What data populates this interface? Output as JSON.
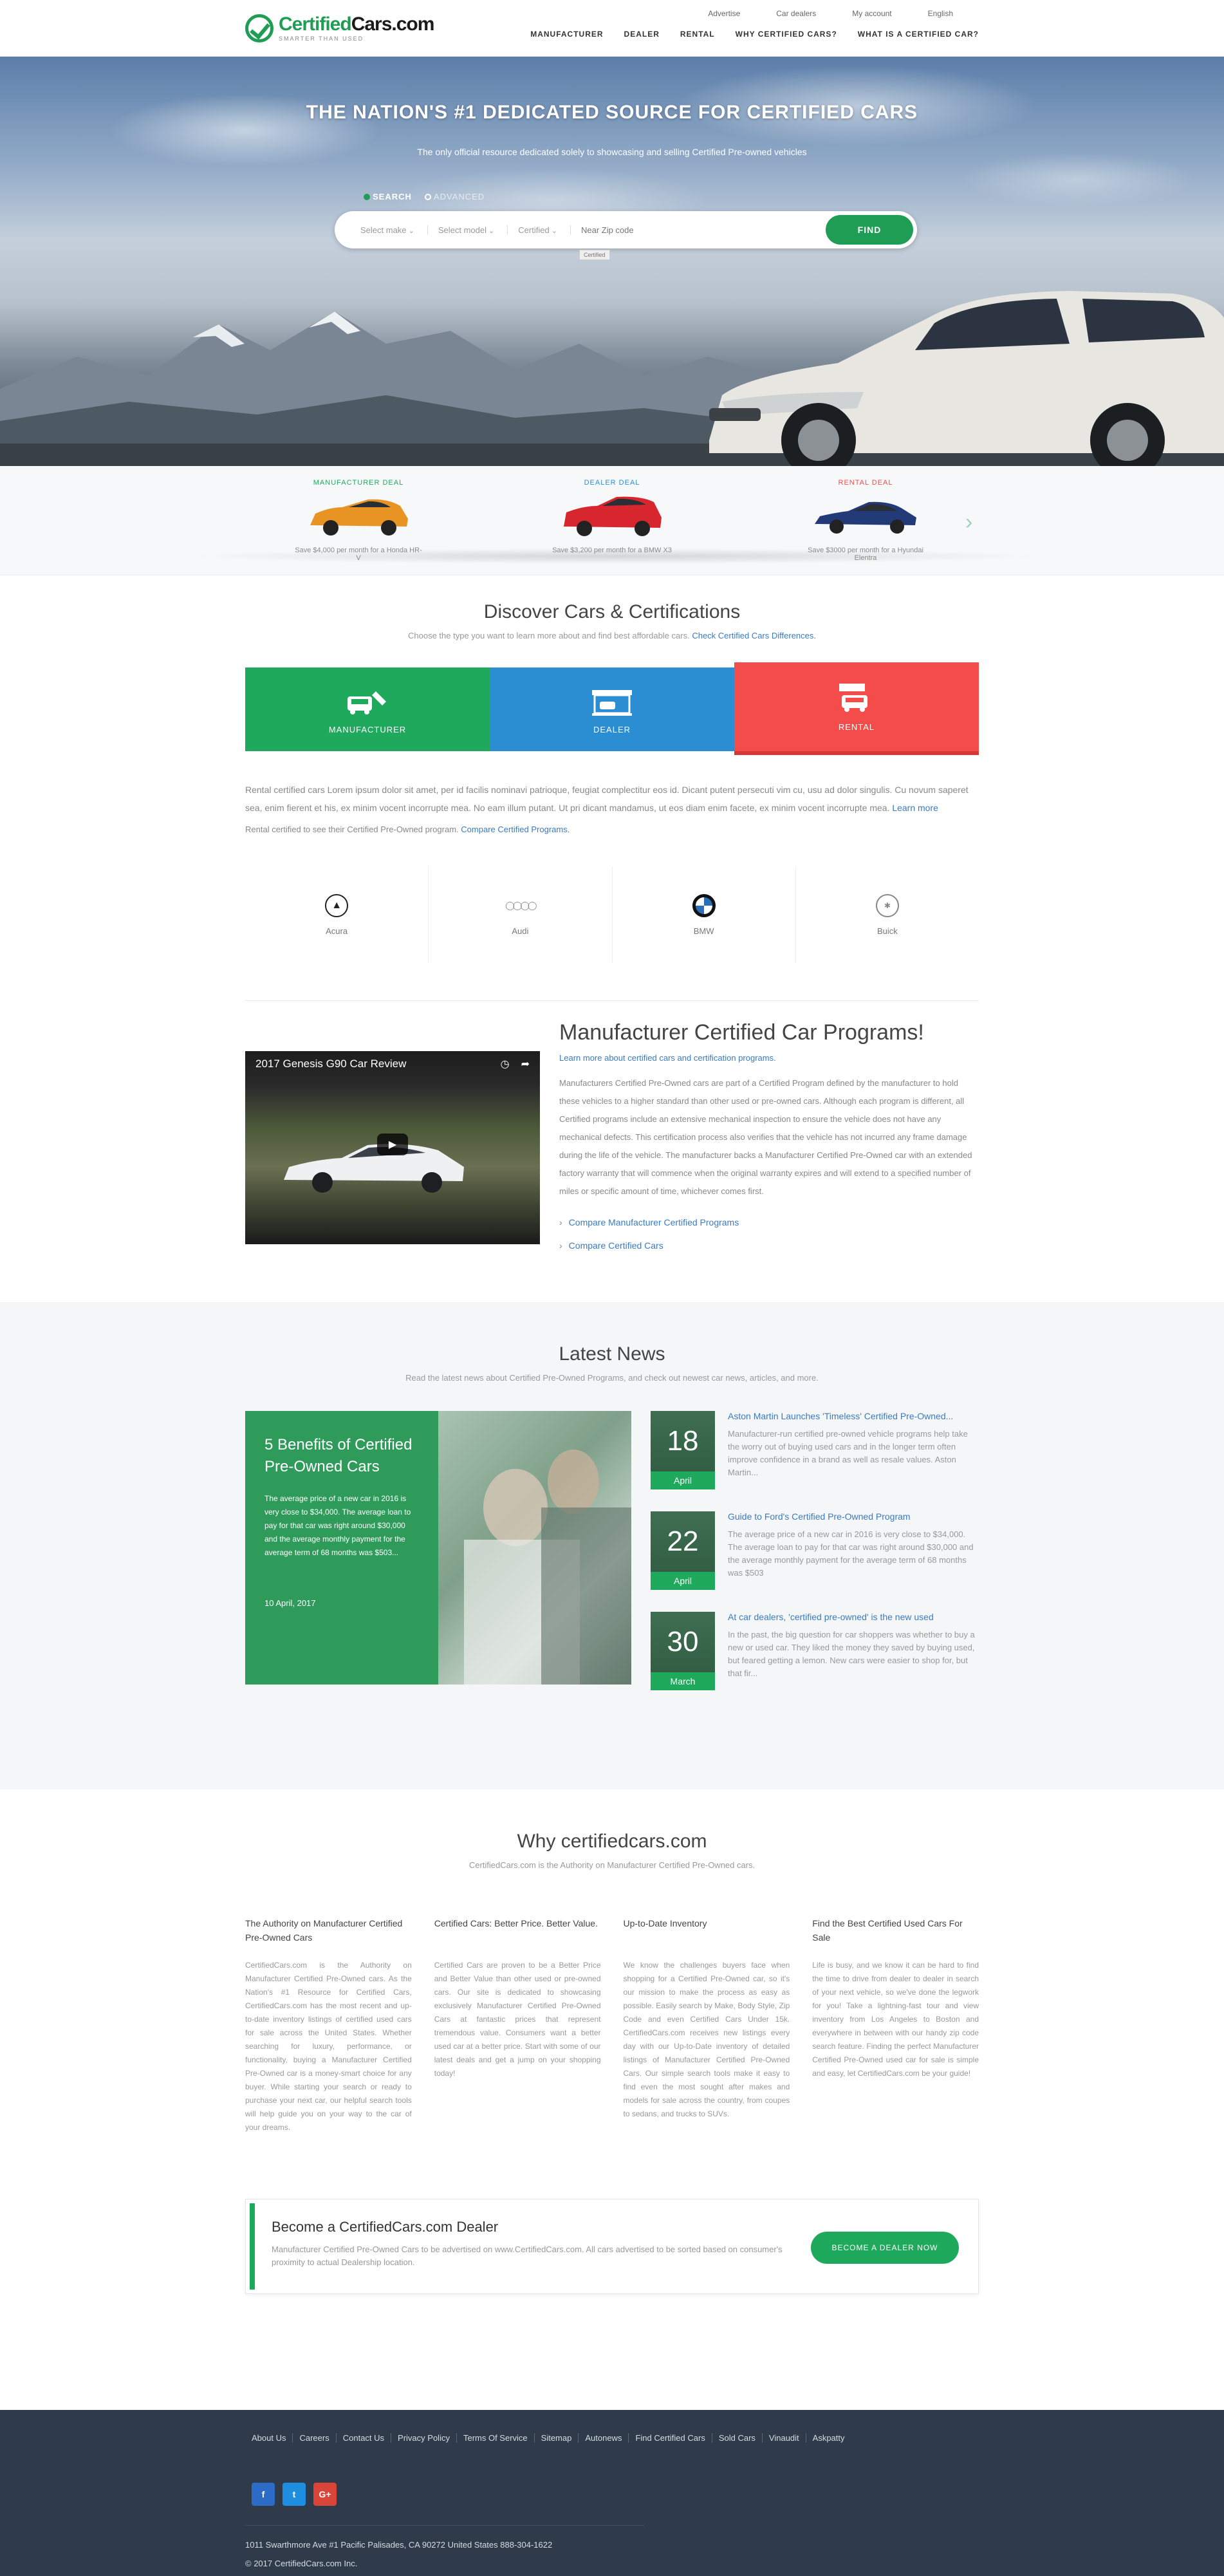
{
  "brand": {
    "name_a": "Certified",
    "name_b": "Cars",
    "name_c": ".com",
    "tagline": "SMARTER THAN USED"
  },
  "topnav": [
    "Advertise",
    "Car dealers",
    "My account",
    "English"
  ],
  "mainnav": [
    "MANUFACTURER",
    "DEALER",
    "RENTAL",
    "WHY CERTIFIED CARS?",
    "WHAT IS A CERTIFIED CAR?"
  ],
  "hero": {
    "title": "THE NATION'S #1 DEDICATED SOURCE FOR CERTIFIED CARS",
    "subtitle": "The only official resource dedicated solely to showcasing and selling Certified Pre-owned vehicles",
    "tab_search": "SEARCH",
    "tab_advanced": "ADVANCED",
    "select_make": "Select make",
    "select_model": "Select model",
    "certified": "Certified",
    "zip_placeholder": "Near Zip code",
    "find": "FIND",
    "cert_tip": "Certified"
  },
  "deals": [
    {
      "title": "MANUFACTURER DEAL",
      "note": "Save $4,000 per month for a Honda HR-V",
      "color": "#1fa95c",
      "car_color": "#e89424"
    },
    {
      "title": "DEALER DEAL",
      "note": "Save $3,200 per month for a BMW X3",
      "color": "#2b8ed2",
      "car_color": "#d8262e"
    },
    {
      "title": "RENTAL DEAL",
      "note": "Save $3000 per month for a Hyundai Elentra",
      "color": "#f44b4b",
      "car_color": "#233a78"
    }
  ],
  "discover": {
    "title": "Discover Cars & Certifications",
    "subtitle": "Choose the type you want to learn more about and find best affordable cars.",
    "subtitle_link": "Check Certified Cars Differences.",
    "tiles": [
      "MANUFACTURER",
      "DEALER",
      "RENTAL"
    ],
    "body": "Rental certified cars Lorem ipsum dolor sit amet, per id facilis nominavi patrioque, feugiat complectitur eos id. Dicant putent persecuti vim cu, usu ad dolor singulis. Cu novum saperet sea, enim fierent et his, ex minim vocent incorrupte mea. No eam illum putant. Ut pri dicant mandamus, ut eos diam enim facete, ex minim vocent incorrupte mea. Learn more",
    "body_link": "Learn more",
    "body2": "Rental certified to see their Certified Pre-Owned program.",
    "body2_link": "Compare Certified Programs.",
    "brands": [
      "Acura",
      "Audi",
      "BMW",
      "Buick"
    ]
  },
  "programs": {
    "video_title": "2017 Genesis G90 Car Review",
    "title": "Manufacturer Certified Car Programs!",
    "lead": "Learn more about certified cars and certification programs.",
    "body": "Manufacturers Certified Pre-Owned cars are part of a Certified Program defined by the manufacturer to hold these vehicles to a higher standard than other used or pre-owned cars. Although each program is different, all Certified programs include an extensive mechanical inspection to ensure the vehicle does not have any mechanical defects. This certification process also verifies that the vehicle has not incurred any frame damage during the life of the vehicle. The manufacturer backs a Manufacturer Certified Pre-Owned car with an extended factory warranty that will commence when the original warranty expires and will extend to a specified number of miles or specific amount of time, whichever comes first.",
    "links": [
      "Compare Manufacturer Certified Programs",
      "Compare Certified Cars"
    ]
  },
  "news": {
    "title": "Latest News",
    "subtitle": "Read the latest news about Certified Pre-Owned Programs, and check out newest car news, articles, and more.",
    "feature": {
      "title": "5 Benefits of Certified Pre-Owned Cars",
      "body": "The average price of a new car in 2016 is very close to $34,000. The average loan to pay for that car was right around $30,000 and the average monthly payment for the average term of 68 months was $503...",
      "date": "10 April, 2017"
    },
    "items": [
      {
        "day": "18",
        "month": "April",
        "title": "Aston Martin Launches 'Timeless' Certified Pre-Owned...",
        "body": "Manufacturer-run certified pre-owned vehicle programs help take the worry out of buying used cars and in the longer term often improve confidence in a brand as well as resale values. Aston Martin..."
      },
      {
        "day": "22",
        "month": "April",
        "title": "Guide to Ford's Certified Pre-Owned Program",
        "body": "The average price of a new car in 2016 is very close to $34,000. The average loan to pay for that car was right around $30,000 and the average monthly payment for the average term of 68 months was $503"
      },
      {
        "day": "30",
        "month": "March",
        "title": "At car dealers, 'certified pre-owned' is the new used",
        "body": "In the past, the big question for car shoppers was whether to buy a new or used car. They liked the money they saved by buying used, but feared getting a lemon. New cars were easier to shop for, but that fir..."
      }
    ]
  },
  "why": {
    "title": "Why certifiedcars.com",
    "subtitle": "CertifiedCars.com is the Authority on Manufacturer Certified Pre-Owned cars.",
    "cols": [
      {
        "title": "The Authority on Manufacturer Certified Pre-Owned Cars",
        "body": "CertifiedCars.com is the Authority on Manufacturer Certified Pre-Owned cars. As the Nation's #1 Resource for Certified Cars, CertifiedCars.com has the most recent and up-to-date inventory listings of certified used cars for sale across the United States. Whether searching for luxury, performance, or functionality, buying a Manufacturer Certified Pre-Owned car is a money-smart choice for any buyer. While starting your search or ready to purchase your next car, our helpful search tools will help guide you on your way to the car of your dreams."
      },
      {
        "title": "Certified Cars: Better Price. Better Value.",
        "body": "Certified Cars are proven to be a Better Price and Better Value than other used or pre-owned cars. Our site is dedicated to showcasing exclusively Manufacturer Certified Pre-Owned Cars at fantastic prices that represent tremendous value. Consumers want a better used car at a better price. Start with some of our latest deals and get a jump on your shopping today!"
      },
      {
        "title": "Up-to-Date Inventory",
        "body": "We know the challenges buyers face when shopping for a Certified Pre-Owned car, so it's our mission to make the process as easy as possible. Easily search by Make, Body Style, Zip Code and even Certified Cars Under 15k. CertifiedCars.com receives new listings every day with our Up-to-Date inventory of detailed listings of Manufacturer Certified Pre-Owned Cars. Our simple search tools make it easy to find even the most sought after makes and models for sale across the country, from coupes to sedans, and trucks to SUVs."
      },
      {
        "title": "Find the Best Certified Used Cars For Sale",
        "body": "Life is busy, and we know it can be hard to find the time to drive from dealer to dealer in search of your next vehicle, so we've done the legwork for you! Take a lightning-fast tour and view inventory from Los Angeles to Boston and everywhere in between with our handy zip code search feature. Finding the perfect Manufacturer Certified Pre-Owned used car for sale is simple and easy, let CertifiedCars.com be your guide!"
      }
    ]
  },
  "dealer_cta": {
    "title": "Become a CertifiedCars.com Dealer",
    "body": "Manufacturer Certified Pre-Owned Cars to be advertised on www.CertifiedCars.com. All cars advertised to be sorted based on consumer's proximity to actual Dealership location.",
    "button": "BECOME A DEALER NOW"
  },
  "footer": {
    "links": [
      "About Us",
      "Careers",
      "Contact Us",
      "Privacy Policy",
      "Terms Of Service",
      "Sitemap",
      "Autonews",
      "Find Certified Cars",
      "Sold Cars",
      "Vinaudit",
      "Askpatty"
    ],
    "social": [
      "f",
      "t",
      "G+"
    ],
    "address": "1011 Swarthmore Ave #1 Pacific Palisades, CA 90272 United States 888-304-1622",
    "copyright": "© 2017 CertifiedCars.com Inc."
  }
}
